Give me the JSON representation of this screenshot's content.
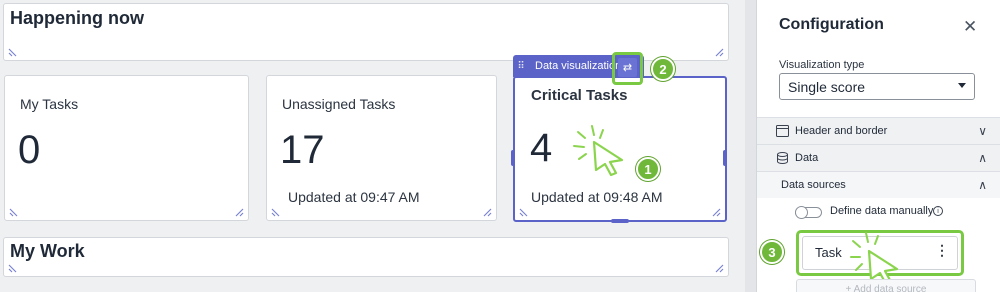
{
  "dashboard": {
    "happening_title": "Happening now",
    "my_work_title": "My Work",
    "tiles": [
      {
        "title": "My Tasks",
        "value": "0",
        "updated": ""
      },
      {
        "title": "Unassigned Tasks",
        "value": "17",
        "updated": "Updated at 09:47 AM"
      },
      {
        "title": "Critical Tasks",
        "value": "4",
        "updated": "Updated at 09:48 AM"
      }
    ],
    "toolbar_label": "Data visualization",
    "accent_color": "#5b63c8",
    "callout_color": "#7ac943"
  },
  "callouts": [
    "1",
    "2",
    "3"
  ],
  "panel": {
    "title": "Configuration",
    "close_icon": "close-icon",
    "viz_type_label": "Visualization type",
    "viz_type_value": "Single score",
    "sections": {
      "header_border": "Header and border",
      "data": "Data",
      "data_sources": "Data sources"
    },
    "define_manually": "Define data manually",
    "data_source_item": "Task",
    "add_data_source": "+ Add data source"
  }
}
